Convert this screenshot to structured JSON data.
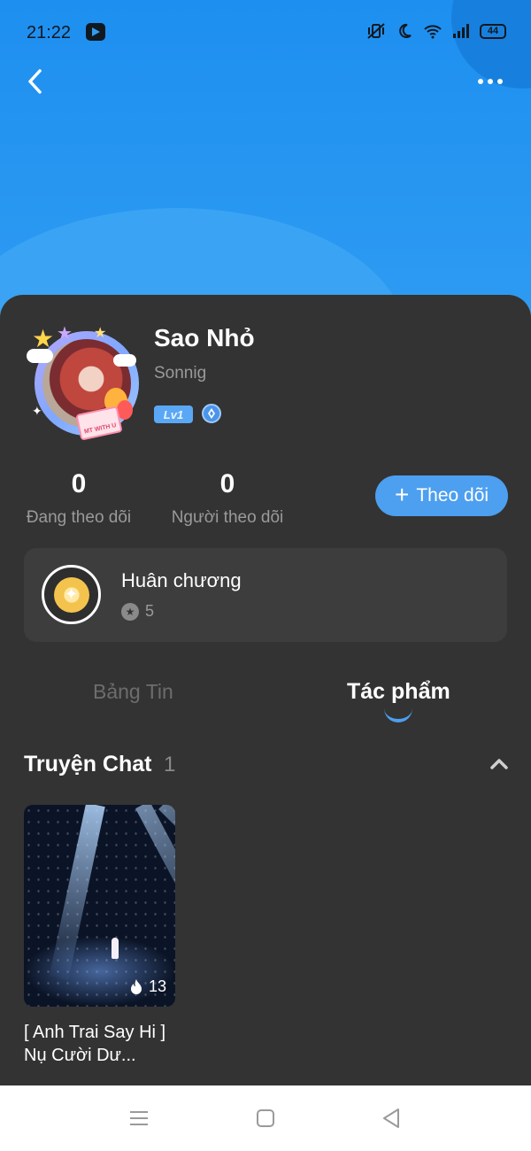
{
  "status_bar": {
    "time": "21:22",
    "battery": "44"
  },
  "colors": {
    "hero_blue": "#2f9cf2",
    "sheet_bg": "#333333",
    "accent": "#4d9ff0"
  },
  "profile": {
    "name": "Sao Nhỏ",
    "handle": "Sonnig",
    "level_badge": "Lv1",
    "avatar_card_text": "MT WITH U"
  },
  "stats": {
    "following_count": "0",
    "following_label": "Đang theo dõi",
    "followers_count": "0",
    "followers_label": "Người theo dõi"
  },
  "follow_button": {
    "plus": "+",
    "label": "Theo dõi"
  },
  "medals": {
    "title": "Huân chương",
    "count": "5"
  },
  "tabs": [
    {
      "label": "Bảng Tin",
      "active": false
    },
    {
      "label": "Tác phẩm",
      "active": true
    }
  ],
  "section": {
    "title": "Truyện Chat",
    "count": "1"
  },
  "stories": [
    {
      "title": "[ Anh Trai Say Hi ] Nụ Cười Dư...",
      "views": "13"
    }
  ],
  "icons": {
    "back": "chevron-left-icon",
    "more": "more-dots-icon",
    "medal_count": "star-circle-icon",
    "collapse": "chevron-up-icon",
    "views": "flame-icon"
  }
}
